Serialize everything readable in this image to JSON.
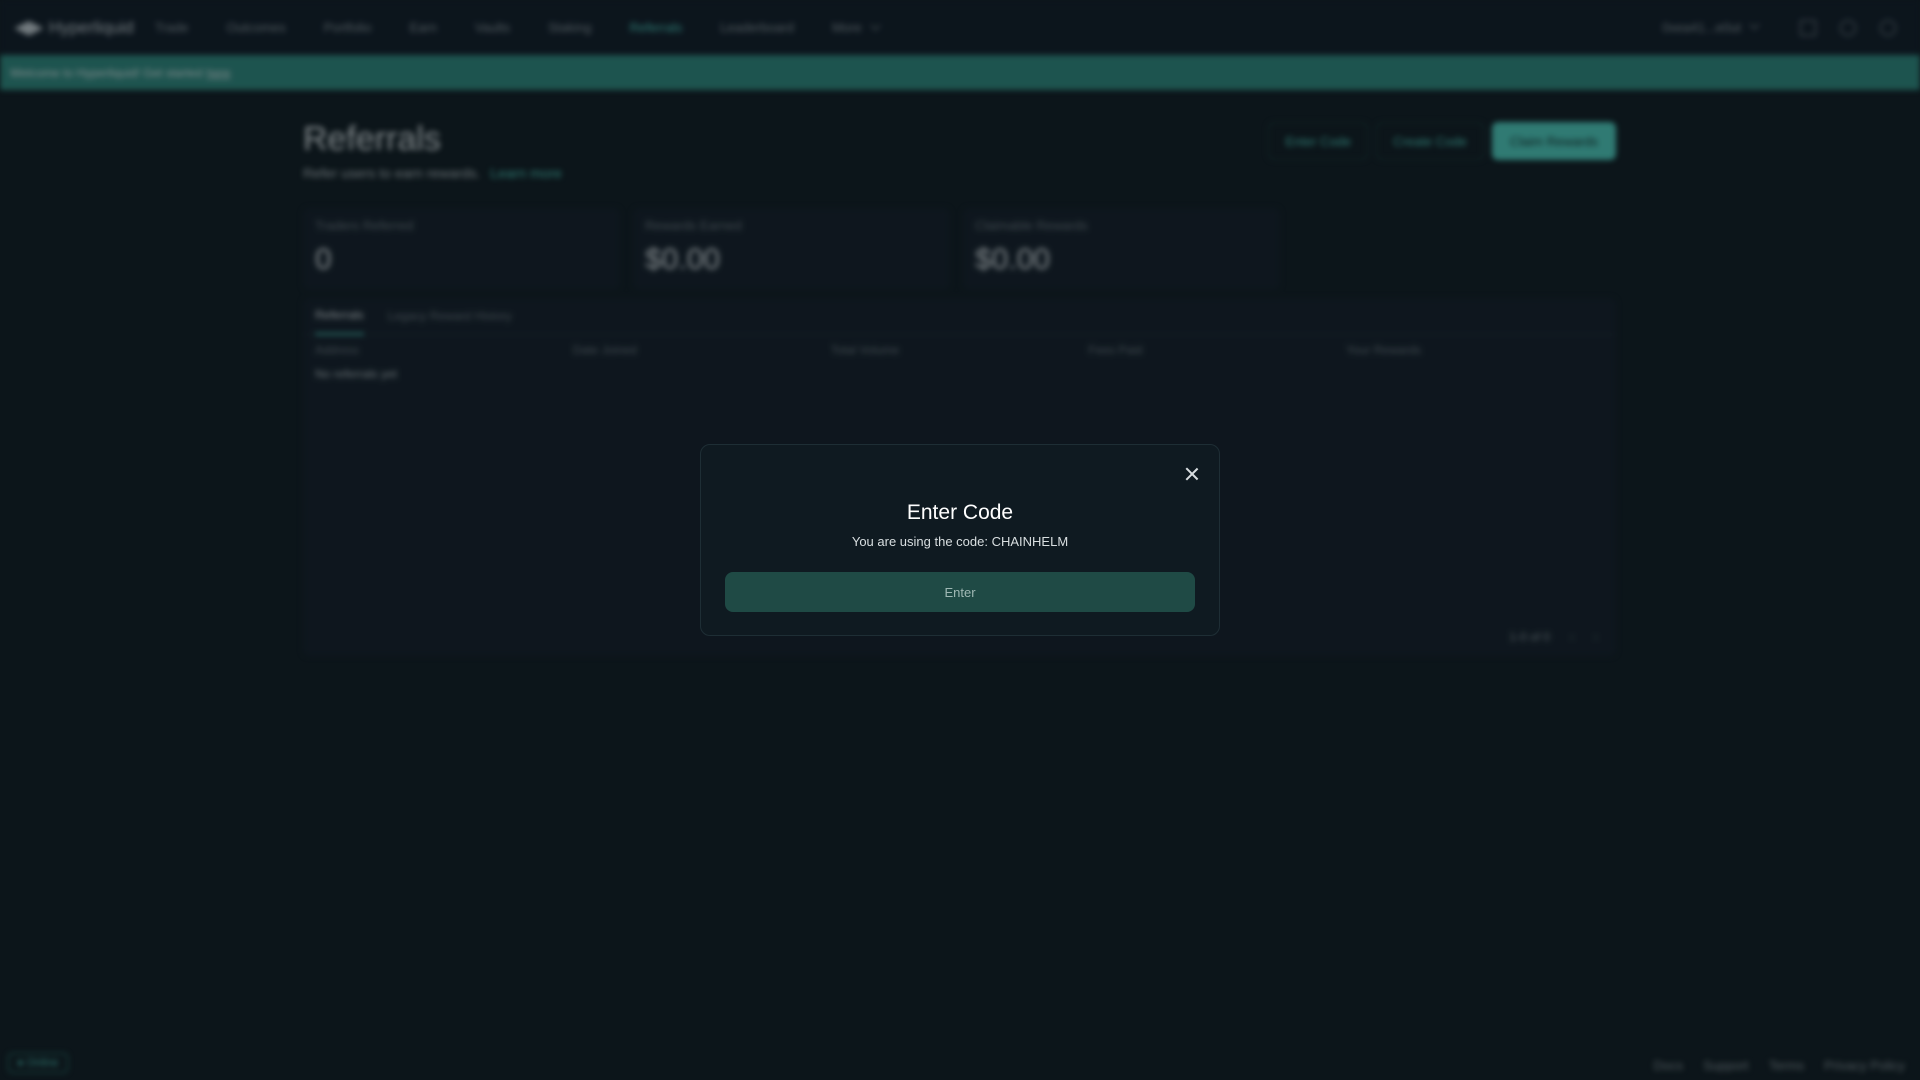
{
  "app": {
    "logo_text": "Hyperliquid"
  },
  "nav": {
    "items": [
      "Trade",
      "Outcomes",
      "Portfolio",
      "Earn",
      "Vaults",
      "Staking",
      "Referrals",
      "Leaderboard",
      "More"
    ],
    "active": "Referrals"
  },
  "topbar": {
    "wallet": "0xea41...e0ut"
  },
  "banner": {
    "text": "Welcome to Hyperliquid! Get started",
    "link": "here"
  },
  "page": {
    "title": "Referrals",
    "subtitle": "Refer users to earn rewards.",
    "learn_more": "Learn more",
    "buttons": {
      "enter_code": "Enter Code",
      "create_code": "Create Code",
      "claim_rewards": "Claim Rewards"
    },
    "stats": [
      {
        "label": "Traders Referred",
        "value": "0"
      },
      {
        "label": "Rewards Earned",
        "value": "$0.00"
      },
      {
        "label": "Claimable Rewards",
        "value": "$0.00"
      }
    ],
    "tabs": [
      "Referrals",
      "Legacy Reward History"
    ],
    "columns": [
      "Address",
      "Date Joined",
      "Total Volume",
      "Fees Paid",
      "Your Rewards"
    ],
    "empty_text": "No referrals yet",
    "pager": "1-0 of 0"
  },
  "footer": {
    "status": "Online",
    "links": [
      "Docs",
      "Support",
      "Terms",
      "Privacy Policy"
    ]
  },
  "modal": {
    "title": "Enter Code",
    "description": "You are using the code: CHAINHELM",
    "button_label": "Enter"
  },
  "colors": {
    "accent": "#50d2c1",
    "background": "#0f1a1f",
    "modal_bg": "#0f1a21",
    "button_bg": "#1f4a45"
  }
}
